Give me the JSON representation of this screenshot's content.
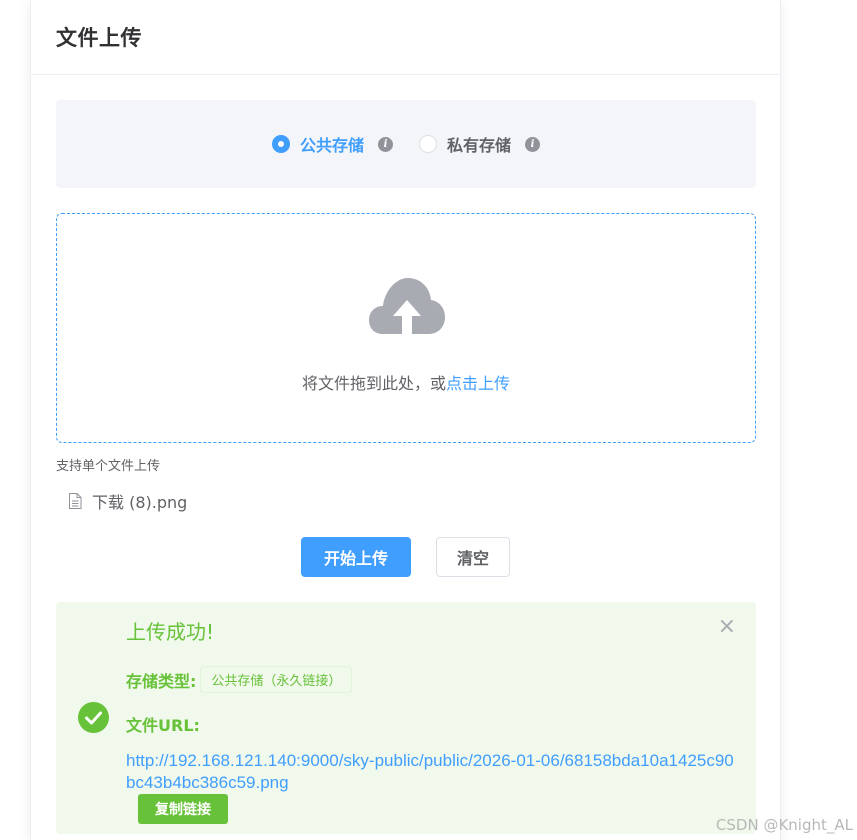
{
  "header": {
    "title": "文件上传"
  },
  "storage": {
    "options": [
      {
        "label": "公共存储",
        "checked": true
      },
      {
        "label": "私有存储",
        "checked": false
      }
    ],
    "info_icon": "i"
  },
  "dropzone": {
    "icon": "cloud-upload-icon",
    "text": "将文件拖到此处，或",
    "link": "点击上传"
  },
  "tip": "支持单个文件上传",
  "file": {
    "icon": "document-icon",
    "name": "下载 (8).png"
  },
  "buttons": {
    "start": "开始上传",
    "clear": "清空"
  },
  "result": {
    "title": "上传成功!",
    "close": "×",
    "type_label": "存储类型:",
    "type_value": "公共存储（永久链接）",
    "url_label": "文件URL:",
    "url": "http://192.168.121.140:9000/sky-public/public/2026-01-06/68158bda10a1425c90bc43b4bc386c59.png",
    "copy": "复制链接"
  },
  "watermark": "CSDN @Knight_AL",
  "colors": {
    "primary": "#409eff",
    "success": "#67c23a",
    "success_bg": "#f0f9eb"
  }
}
